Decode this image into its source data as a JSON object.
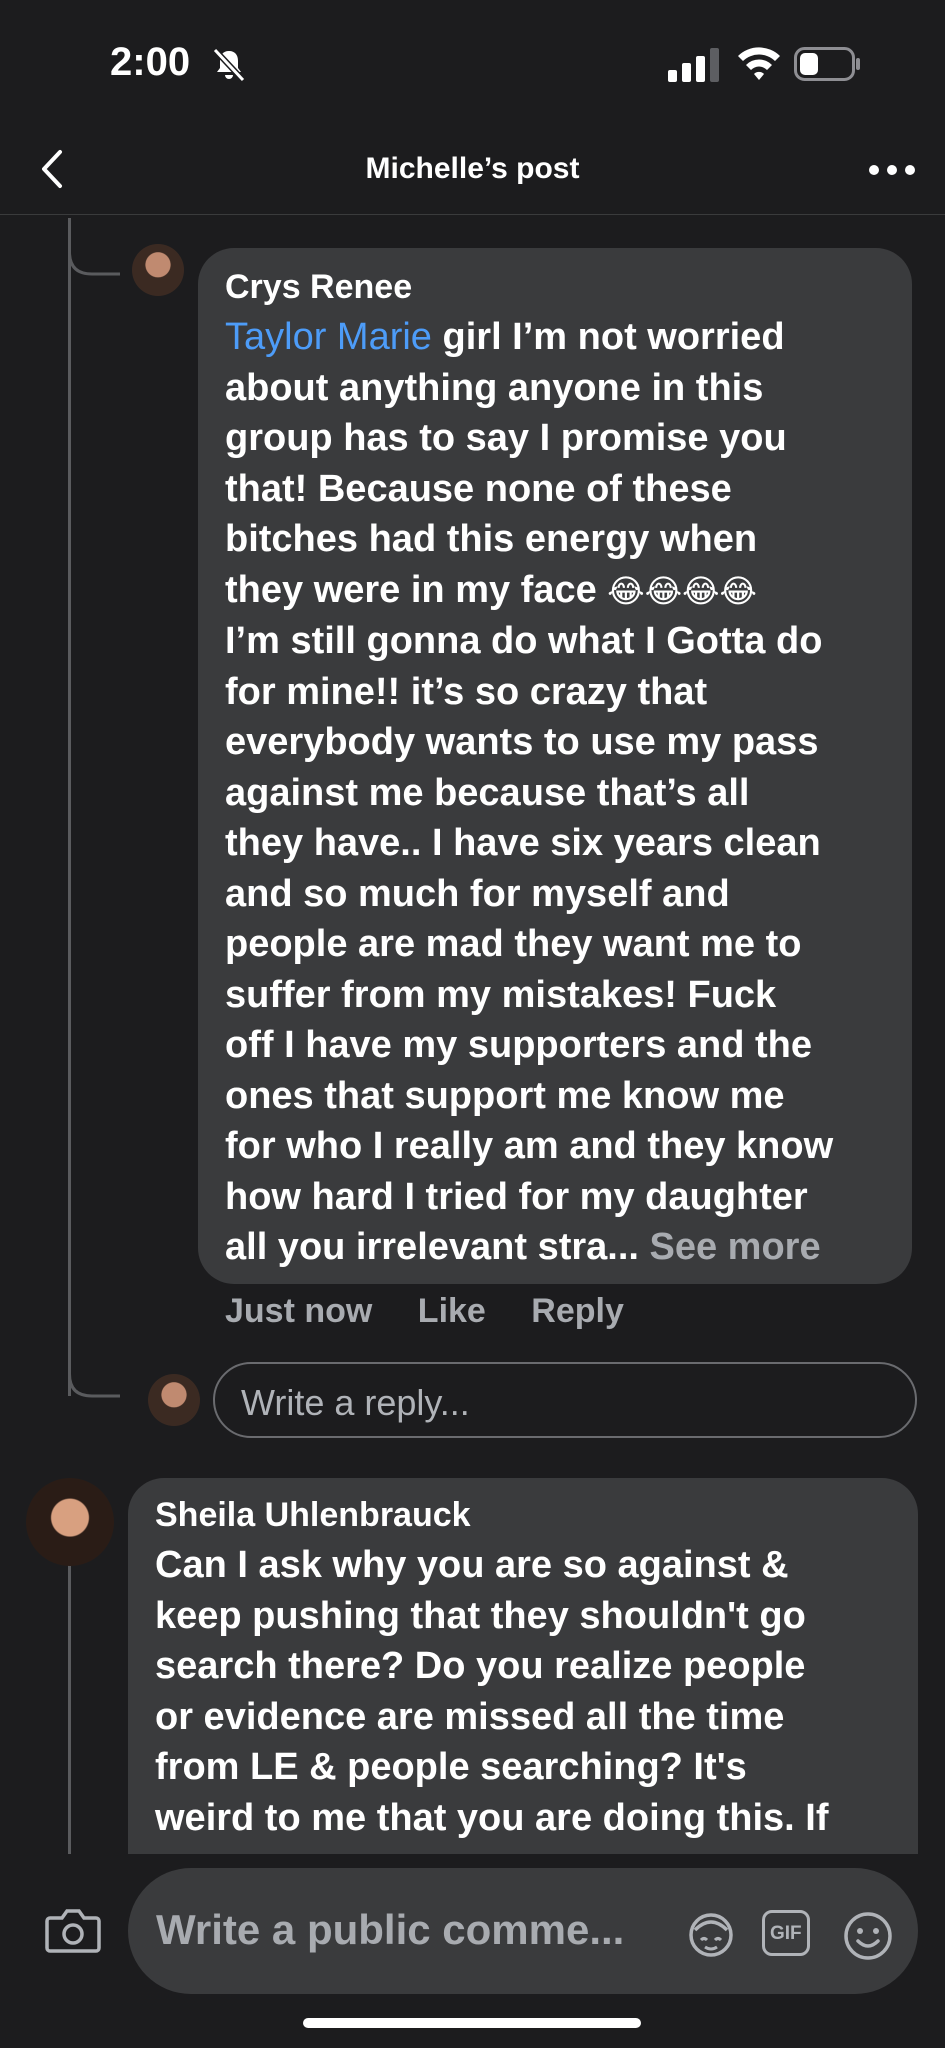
{
  "status_bar": {
    "time": "2:00"
  },
  "header": {
    "title": "Michelle’s post"
  },
  "comments": [
    {
      "author": "Crys Renee",
      "mention": "Taylor Marie",
      "text_lines": [
        " girl I’m not worried",
        "about anything anyone in this",
        "group has to say I promise you",
        "that! Because none of these",
        "bitches had this energy when",
        "they were in my face ",
        "I’m still gonna do what I Gotta do",
        "for mine!! it’s so crazy that",
        "everybody wants to use my pass",
        "against me because that’s all",
        "they have.. I have six years clean",
        "and so much for myself and",
        "people are mad they want me to",
        "suffer from my mistakes! Fuck",
        "off I have my supporters and the",
        "ones that support me know me",
        "for who I really am and they know",
        "how hard I tried for my daughter",
        "all you irrelevant stra... "
      ],
      "emojis": "😂😂😂😂",
      "see_more": "See more",
      "time": "Just now",
      "like": "Like",
      "reply": "Reply"
    },
    {
      "author": "Sheila Uhlenbrauck",
      "text_lines": [
        "Can I ask why you are so against &",
        "keep pushing that they shouldn't go",
        "search there? Do you realize people",
        "or evidence are missed all the time",
        "from LE & people searching? It's",
        "weird to me that you are doing this. If"
      ]
    }
  ],
  "reply_box": {
    "placeholder": "Write a reply..."
  },
  "composer": {
    "placeholder": "Write a public comme...",
    "gif_label": "GIF"
  }
}
